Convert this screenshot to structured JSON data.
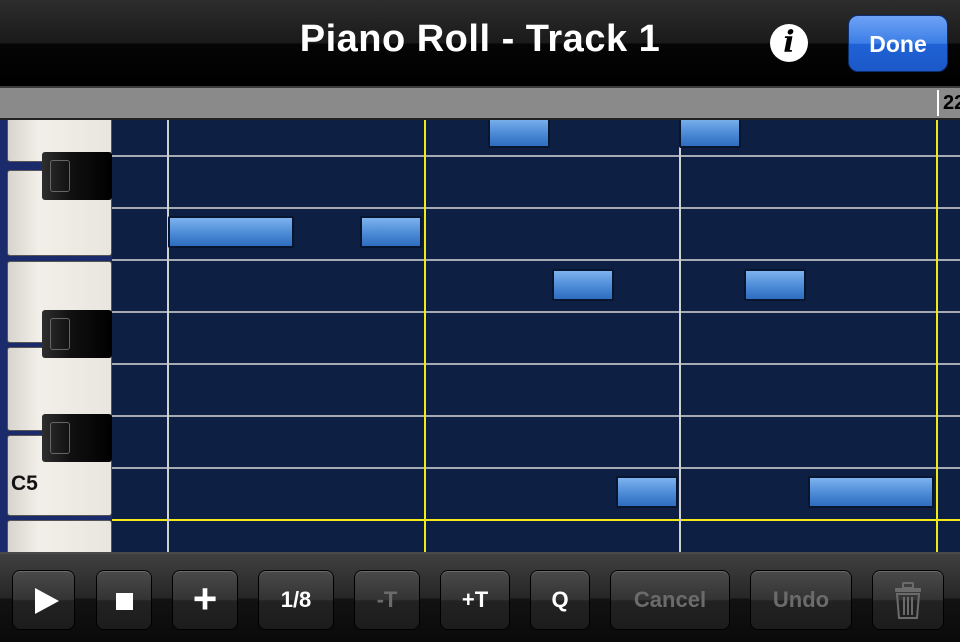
{
  "navbar": {
    "title": "Piano Roll - Track 1",
    "info_label": "i",
    "done_label": "Done"
  },
  "ruler": {
    "marker_label": "22"
  },
  "keyboard": {
    "octave_label": "C5"
  },
  "toolbar": {
    "play_icon": "play-icon",
    "stop_icon": "stop-icon",
    "add_label": "+",
    "grid_label": "1/8",
    "transpose_down_label": "-T",
    "transpose_up_label": "+T",
    "quantize_label": "Q",
    "cancel_label": "Cancel",
    "undo_label": "Undo",
    "delete_icon": "trash-icon"
  },
  "colors": {
    "grid_background": "#0e1f44",
    "note_fill": "#4f8ed8",
    "bar_line": "#f2ea18",
    "done_button": "#3b7ee6"
  }
}
